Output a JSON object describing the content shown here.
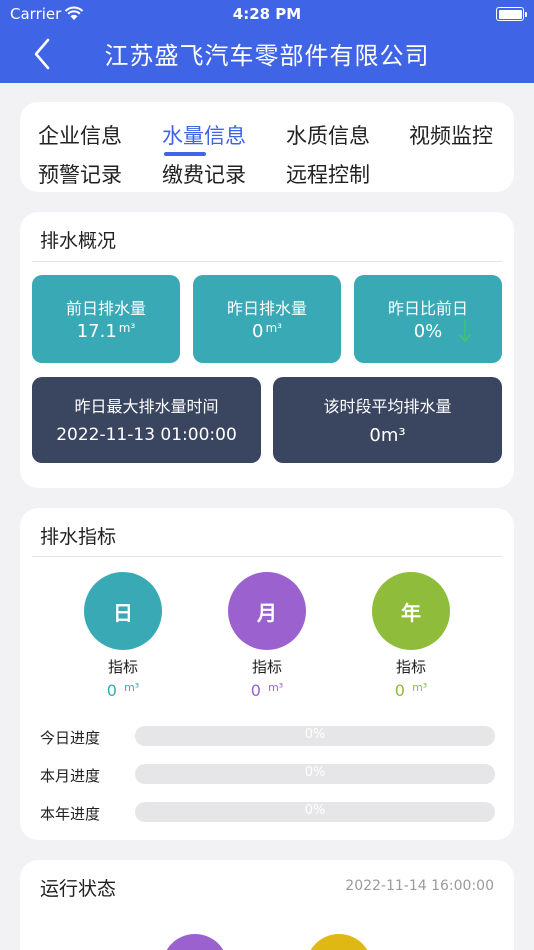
{
  "status_bar": {
    "carrier": "Carrier",
    "time": "4:28 PM"
  },
  "nav": {
    "title": "江苏盛飞汽车零部件有限公司",
    "back_icon": "chevron-left-icon"
  },
  "tabs": [
    {
      "label": "企业信息",
      "active": false
    },
    {
      "label": "水量信息",
      "active": true
    },
    {
      "label": "水质信息",
      "active": false
    },
    {
      "label": "视频监控",
      "active": false
    },
    {
      "label": "预警记录",
      "active": false
    },
    {
      "label": "缴费记录",
      "active": false
    },
    {
      "label": "远程控制",
      "active": false
    }
  ],
  "overview": {
    "title": "排水概况",
    "prev_day": {
      "label": "前日排水量",
      "value": "17.1",
      "unit": "m³"
    },
    "yesterday": {
      "label": "昨日排水量",
      "value": "0",
      "unit": "m³"
    },
    "ratio": {
      "label": "昨日比前日",
      "value": "0%",
      "trend_icon": "arrow-down-icon"
    },
    "max_time": {
      "label": "昨日最大排水量时间",
      "value": "2022-11-13 01:00:00"
    },
    "avg": {
      "label": "该时段平均排水量",
      "value": "0m³"
    }
  },
  "indicators": {
    "title": "排水指标",
    "items": [
      {
        "badge": "日",
        "label": "指标",
        "value": "0",
        "unit": "m³",
        "color": "#3aa9b6"
      },
      {
        "badge": "月",
        "label": "指标",
        "value": "0",
        "unit": "m³",
        "color": "#9b62cf"
      },
      {
        "badge": "年",
        "label": "指标",
        "value": "0",
        "unit": "m³",
        "color": "#8fbc3a"
      }
    ],
    "progress": [
      {
        "label": "今日进度",
        "text": "0%",
        "fraction": 0
      },
      {
        "label": "本月进度",
        "text": "0%",
        "fraction": 0
      },
      {
        "label": "本年进度",
        "text": "0%",
        "fraction": 0
      }
    ]
  },
  "run_status": {
    "title": "运行状态",
    "time": "2022-11-14 16:00:00",
    "colors": [
      "#9b62cf",
      "#e0b814"
    ]
  },
  "colors": {
    "primary": "#3f64e6",
    "teal": "#3aa9b6",
    "navy": "#3a4560",
    "green_arrow": "#3fbf7f"
  }
}
